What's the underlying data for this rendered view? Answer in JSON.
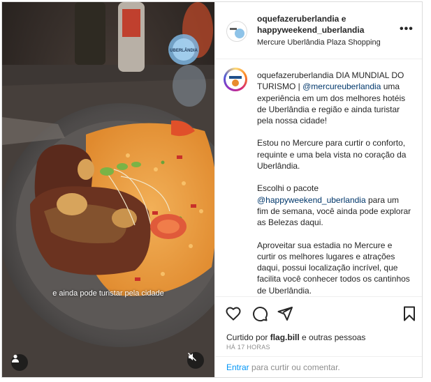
{
  "post": {
    "header": {
      "title": "oquefazeruberlandia e happyweekend_uberlandia",
      "location": "Mercure Uberlândia Plaza Shopping",
      "more_label": "•••"
    },
    "media": {
      "overlay_caption": "e ainda pode turistar pela cidade",
      "badge_text": "UBERLÂNDIA"
    },
    "caption": {
      "username": "oquefazeruberlandia",
      "paragraph1_lead": "DIA MUNDIAL DO TURISMO | ",
      "mention1": "@mercureuberlandia",
      "paragraph1_rest": " uma experiência em um dos melhores hotéis de Uberlândia e região e ainda turistar pela nossa cidade!",
      "paragraph2": "Estou no Mercure para curtir o conforto, requinte e uma bela vista no coração da Uberlândia.",
      "paragraph3_lead": "Escolhi o pacote ",
      "mention2": "@happyweekend_uberlandia",
      "paragraph3_rest": " para um fim de semana, você ainda pode explorar as Belezas daqui.",
      "paragraph4": "Aproveitar sua estadia no Mercure e curtir os melhores lugares e atrações daqui, possui localização incrível, que facilita você conhecer todos os cantinhos de Uberlândia."
    },
    "actions": {
      "like_icon": "heart-icon",
      "comment_icon": "comment-icon",
      "share_icon": "send-icon",
      "save_icon": "bookmark-icon"
    },
    "likes": {
      "prefix": "Curtido por ",
      "user": "flag.bill",
      "suffix": " e outras pessoas"
    },
    "timestamp": "HÁ 17 HORAS",
    "comment": {
      "login_link": "Entrar",
      "prompt": " para curtir ou comentar."
    }
  }
}
